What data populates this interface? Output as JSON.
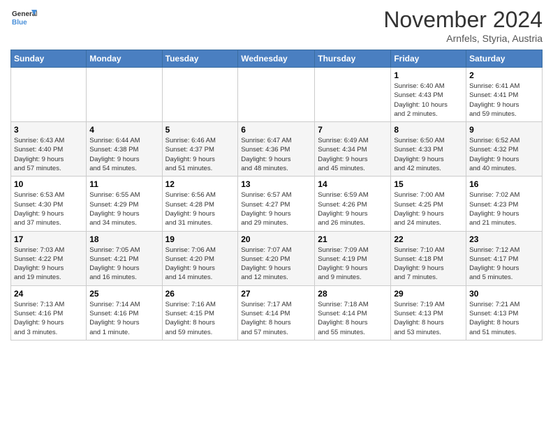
{
  "logo": {
    "line1": "General",
    "line2": "Blue"
  },
  "title": "November 2024",
  "subtitle": "Arnfels, Styria, Austria",
  "days_of_week": [
    "Sunday",
    "Monday",
    "Tuesday",
    "Wednesday",
    "Thursday",
    "Friday",
    "Saturday"
  ],
  "weeks": [
    [
      {
        "day": "",
        "info": ""
      },
      {
        "day": "",
        "info": ""
      },
      {
        "day": "",
        "info": ""
      },
      {
        "day": "",
        "info": ""
      },
      {
        "day": "",
        "info": ""
      },
      {
        "day": "1",
        "info": "Sunrise: 6:40 AM\nSunset: 4:43 PM\nDaylight: 10 hours\nand 2 minutes."
      },
      {
        "day": "2",
        "info": "Sunrise: 6:41 AM\nSunset: 4:41 PM\nDaylight: 9 hours\nand 59 minutes."
      }
    ],
    [
      {
        "day": "3",
        "info": "Sunrise: 6:43 AM\nSunset: 4:40 PM\nDaylight: 9 hours\nand 57 minutes."
      },
      {
        "day": "4",
        "info": "Sunrise: 6:44 AM\nSunset: 4:38 PM\nDaylight: 9 hours\nand 54 minutes."
      },
      {
        "day": "5",
        "info": "Sunrise: 6:46 AM\nSunset: 4:37 PM\nDaylight: 9 hours\nand 51 minutes."
      },
      {
        "day": "6",
        "info": "Sunrise: 6:47 AM\nSunset: 4:36 PM\nDaylight: 9 hours\nand 48 minutes."
      },
      {
        "day": "7",
        "info": "Sunrise: 6:49 AM\nSunset: 4:34 PM\nDaylight: 9 hours\nand 45 minutes."
      },
      {
        "day": "8",
        "info": "Sunrise: 6:50 AM\nSunset: 4:33 PM\nDaylight: 9 hours\nand 42 minutes."
      },
      {
        "day": "9",
        "info": "Sunrise: 6:52 AM\nSunset: 4:32 PM\nDaylight: 9 hours\nand 40 minutes."
      }
    ],
    [
      {
        "day": "10",
        "info": "Sunrise: 6:53 AM\nSunset: 4:30 PM\nDaylight: 9 hours\nand 37 minutes."
      },
      {
        "day": "11",
        "info": "Sunrise: 6:55 AM\nSunset: 4:29 PM\nDaylight: 9 hours\nand 34 minutes."
      },
      {
        "day": "12",
        "info": "Sunrise: 6:56 AM\nSunset: 4:28 PM\nDaylight: 9 hours\nand 31 minutes."
      },
      {
        "day": "13",
        "info": "Sunrise: 6:57 AM\nSunset: 4:27 PM\nDaylight: 9 hours\nand 29 minutes."
      },
      {
        "day": "14",
        "info": "Sunrise: 6:59 AM\nSunset: 4:26 PM\nDaylight: 9 hours\nand 26 minutes."
      },
      {
        "day": "15",
        "info": "Sunrise: 7:00 AM\nSunset: 4:25 PM\nDaylight: 9 hours\nand 24 minutes."
      },
      {
        "day": "16",
        "info": "Sunrise: 7:02 AM\nSunset: 4:23 PM\nDaylight: 9 hours\nand 21 minutes."
      }
    ],
    [
      {
        "day": "17",
        "info": "Sunrise: 7:03 AM\nSunset: 4:22 PM\nDaylight: 9 hours\nand 19 minutes."
      },
      {
        "day": "18",
        "info": "Sunrise: 7:05 AM\nSunset: 4:21 PM\nDaylight: 9 hours\nand 16 minutes."
      },
      {
        "day": "19",
        "info": "Sunrise: 7:06 AM\nSunset: 4:20 PM\nDaylight: 9 hours\nand 14 minutes."
      },
      {
        "day": "20",
        "info": "Sunrise: 7:07 AM\nSunset: 4:20 PM\nDaylight: 9 hours\nand 12 minutes."
      },
      {
        "day": "21",
        "info": "Sunrise: 7:09 AM\nSunset: 4:19 PM\nDaylight: 9 hours\nand 9 minutes."
      },
      {
        "day": "22",
        "info": "Sunrise: 7:10 AM\nSunset: 4:18 PM\nDaylight: 9 hours\nand 7 minutes."
      },
      {
        "day": "23",
        "info": "Sunrise: 7:12 AM\nSunset: 4:17 PM\nDaylight: 9 hours\nand 5 minutes."
      }
    ],
    [
      {
        "day": "24",
        "info": "Sunrise: 7:13 AM\nSunset: 4:16 PM\nDaylight: 9 hours\nand 3 minutes."
      },
      {
        "day": "25",
        "info": "Sunrise: 7:14 AM\nSunset: 4:16 PM\nDaylight: 9 hours\nand 1 minute."
      },
      {
        "day": "26",
        "info": "Sunrise: 7:16 AM\nSunset: 4:15 PM\nDaylight: 8 hours\nand 59 minutes."
      },
      {
        "day": "27",
        "info": "Sunrise: 7:17 AM\nSunset: 4:14 PM\nDaylight: 8 hours\nand 57 minutes."
      },
      {
        "day": "28",
        "info": "Sunrise: 7:18 AM\nSunset: 4:14 PM\nDaylight: 8 hours\nand 55 minutes."
      },
      {
        "day": "29",
        "info": "Sunrise: 7:19 AM\nSunset: 4:13 PM\nDaylight: 8 hours\nand 53 minutes."
      },
      {
        "day": "30",
        "info": "Sunrise: 7:21 AM\nSunset: 4:13 PM\nDaylight: 8 hours\nand 51 minutes."
      }
    ]
  ]
}
